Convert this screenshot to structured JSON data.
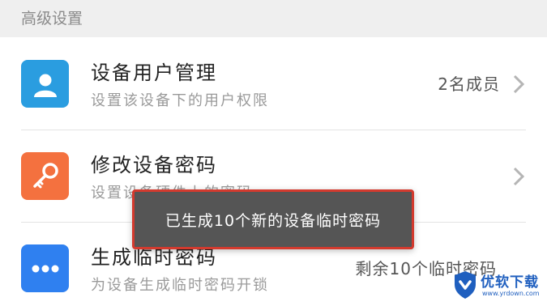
{
  "header": {
    "title": "高级设置"
  },
  "rows": [
    {
      "title": "设备用户管理",
      "subtitle": "设置该设备下的用户权限",
      "value": "2名成员",
      "icon": "user-icon",
      "icon_color": "#2a9de0"
    },
    {
      "title": "修改设备密码",
      "subtitle": "设置设备硬件上的密码",
      "value": "",
      "icon": "key-icon",
      "icon_color": "#f4713f"
    },
    {
      "title": "生成临时密码",
      "subtitle": "为设备生成临时密码开锁",
      "value": "剩余10个临时密码",
      "icon": "more-dots-icon",
      "icon_color": "#2f80f0"
    }
  ],
  "toast": {
    "message": "已生成10个新的设备临时密码"
  },
  "watermark": {
    "name": "优软下载",
    "url": "www.yrdown.com",
    "color": "#1f5fbf"
  }
}
